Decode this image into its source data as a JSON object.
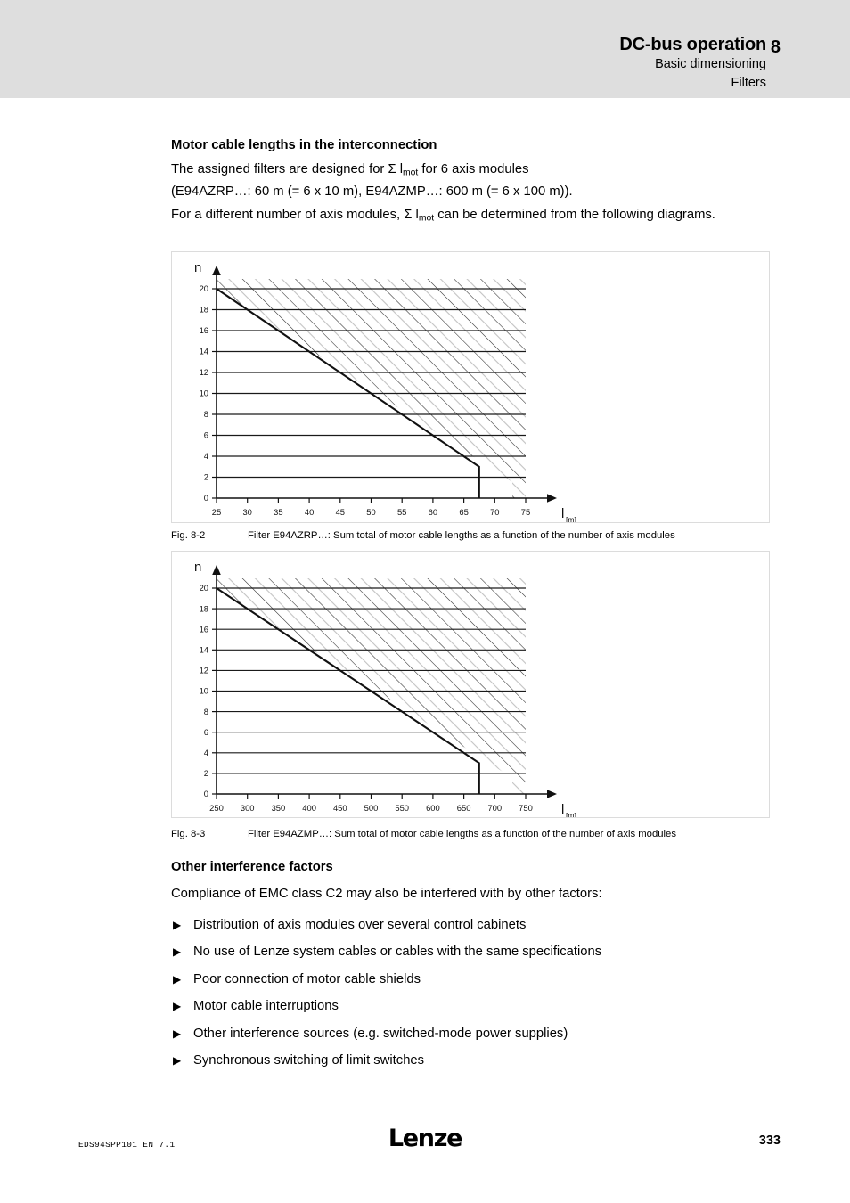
{
  "header": {
    "title": "DC-bus operation",
    "subtitle_1": "Basic dimensioning",
    "subtitle_2": "Filters",
    "chapter": "8",
    "band_color": "#dedede"
  },
  "content": {
    "heading_1": "Motor cable lengths in the interconnection",
    "para_1_a": "The assigned filters are designed for Σ l",
    "para_1_sub": "mot",
    "para_1_b": " for 6 axis modules",
    "para_1_line2": "(E94AZRP…: 60 m (= 6 x 10 m), E94AZMP…: 600 m (= 6 x 100 m)).",
    "para_2_a": "For a different number of axis modules, Σ l",
    "para_2_sub": "mot",
    "para_2_b": " can be determined from the following diagrams.",
    "heading_2": "Other interference factors",
    "para_3": "Compliance of EMC class C2 may also be interfered with by other factors:",
    "bullet_glyph": "▶",
    "bullets": [
      "Distribution of axis modules over several control cabinets",
      "No use of Lenze system cables or cables with the same specifications",
      "Poor connection of motor cable shields",
      "Motor cable interruptions",
      "Other interference sources (e.g. switched-mode power supplies)",
      "Synchronous switching of limit switches"
    ]
  },
  "figures": [
    {
      "label": "Fig. 8-2",
      "caption": "Filter E94AZRP…: Sum total of motor cable lengths as a function of the number of axis modules"
    },
    {
      "label": "Fig. 8-3",
      "caption": "Filter E94AZMP…: Sum total of motor cable lengths as a function of the number of axis modules"
    }
  ],
  "chart_data": [
    {
      "type": "line",
      "title": "Filter E94AZRP…: Sum total of motor cable lengths as a function of the number of axis modules",
      "xlabel": "l",
      "xlabel_sub": "[m]",
      "ylabel": "n",
      "xlim": [
        25,
        75
      ],
      "ylim": [
        0,
        20
      ],
      "xticks": [
        25,
        30,
        35,
        40,
        45,
        50,
        55,
        60,
        65,
        70,
        75
      ],
      "yticks": [
        0,
        2,
        4,
        6,
        8,
        10,
        12,
        14,
        16,
        18,
        20
      ],
      "grid": "horizontal",
      "legend": "none",
      "series": [
        {
          "name": "limit curve",
          "x": [
            25,
            67.5,
            67.5
          ],
          "y": [
            20,
            3,
            0
          ]
        }
      ],
      "hatched_region": "above and right of limit curve (not permissible)",
      "note": "6 axis modules correspond to 60 m total motor cable length"
    },
    {
      "type": "line",
      "title": "Filter E94AZMP…: Sum total of motor cable lengths as a function of the number of axis modules",
      "xlabel": "l",
      "xlabel_sub": "[m]",
      "ylabel": "n",
      "xlim": [
        250,
        750
      ],
      "ylim": [
        0,
        20
      ],
      "xticks": [
        250,
        300,
        350,
        400,
        450,
        500,
        550,
        600,
        650,
        700,
        750
      ],
      "yticks": [
        0,
        2,
        4,
        6,
        8,
        10,
        12,
        14,
        16,
        18,
        20
      ],
      "grid": "horizontal",
      "legend": "none",
      "series": [
        {
          "name": "limit curve",
          "x": [
            250,
            675,
            675
          ],
          "y": [
            20,
            3,
            0
          ]
        }
      ],
      "hatched_region": "above and right of limit curve (not permissible)",
      "note": "6 axis modules correspond to 600 m total motor cable length"
    }
  ],
  "footer": {
    "doc_id": "EDS94SPP101 EN 7.1",
    "logo": "Lenze",
    "page": "333"
  }
}
